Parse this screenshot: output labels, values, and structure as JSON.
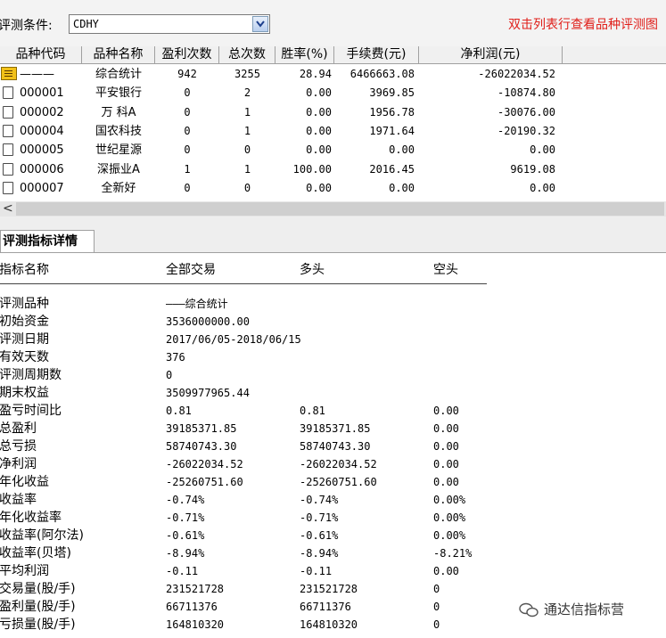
{
  "filter": {
    "label": "评测条件:",
    "value": "CDHY",
    "hint": "双击列表行查看品种评测图"
  },
  "table": {
    "columns": [
      "品种代码",
      "品种名称",
      "盈利次数",
      "总次数",
      "胜率(%)",
      "手续费(元)",
      "净利润(元)"
    ],
    "rows": [
      {
        "code": "———",
        "name": "综合统计",
        "wins": "942",
        "total": "3255",
        "rate": "28.94",
        "fee": "6466663.08",
        "profit": "-26022034.52",
        "icon": "summary-icon"
      },
      {
        "code": "000001",
        "name": "平安银行",
        "wins": "0",
        "total": "2",
        "rate": "0.00",
        "fee": "3969.85",
        "profit": "-10874.80",
        "icon": "document-icon"
      },
      {
        "code": "000002",
        "name": "万 科A",
        "wins": "0",
        "total": "1",
        "rate": "0.00",
        "fee": "1956.78",
        "profit": "-30076.00",
        "icon": "document-icon"
      },
      {
        "code": "000004",
        "name": "国农科技",
        "wins": "0",
        "total": "1",
        "rate": "0.00",
        "fee": "1971.64",
        "profit": "-20190.32",
        "icon": "document-icon"
      },
      {
        "code": "000005",
        "name": "世纪星源",
        "wins": "0",
        "total": "0",
        "rate": "0.00",
        "fee": "0.00",
        "profit": "0.00",
        "icon": "document-icon"
      },
      {
        "code": "000006",
        "name": "深振业A",
        "wins": "1",
        "total": "1",
        "rate": "100.00",
        "fee": "2016.45",
        "profit": "9619.08",
        "icon": "document-icon"
      },
      {
        "code": "000007",
        "name": "全新好",
        "wins": "0",
        "total": "0",
        "rate": "0.00",
        "fee": "0.00",
        "profit": "0.00",
        "icon": "document-icon"
      }
    ]
  },
  "scroll": {
    "left_arrow": "<"
  },
  "tab": {
    "label": "评测指标详情"
  },
  "details": {
    "headers": [
      "指标名称",
      "全部交易",
      "多头",
      "空头"
    ],
    "rows": [
      {
        "name": "评测品种",
        "all": "———综合统计",
        "long": "",
        "short": ""
      },
      {
        "name": "初始资金",
        "all": "3536000000.00",
        "long": "",
        "short": ""
      },
      {
        "name": "评测日期",
        "all": "2017/06/05-2018/06/15",
        "long": "",
        "short": ""
      },
      {
        "name": "有效天数",
        "all": "376",
        "long": "",
        "short": ""
      },
      {
        "name": "评测周期数",
        "all": "0",
        "long": "",
        "short": ""
      },
      {
        "name": "期末权益",
        "all": "3509977965.44",
        "long": "",
        "short": ""
      },
      {
        "name": "盈亏时间比",
        "all": "0.81",
        "long": "0.81",
        "short": "0.00"
      },
      {
        "name": "总盈利",
        "all": "39185371.85",
        "long": "39185371.85",
        "short": "0.00"
      },
      {
        "name": "总亏损",
        "all": "58740743.30",
        "long": "58740743.30",
        "short": "0.00"
      },
      {
        "name": "净利润",
        "all": "-26022034.52",
        "long": "-26022034.52",
        "short": "0.00"
      },
      {
        "name": "年化收益",
        "all": "-25260751.60",
        "long": "-25260751.60",
        "short": "0.00"
      },
      {
        "name": "收益率",
        "all": "-0.74%",
        "long": "-0.74%",
        "short": "0.00%"
      },
      {
        "name": "年化收益率",
        "all": "-0.71%",
        "long": "-0.71%",
        "short": "0.00%"
      },
      {
        "name": "收益率(阿尔法)",
        "all": "-0.61%",
        "long": "-0.61%",
        "short": "0.00%"
      },
      {
        "name": "收益率(贝塔)",
        "all": "-8.94%",
        "long": "-8.94%",
        "short": "-8.21%"
      },
      {
        "name": "平均利润",
        "all": "-0.11",
        "long": "-0.11",
        "short": "0.00"
      },
      {
        "name": "交易量(股/手)",
        "all": "231521728",
        "long": "231521728",
        "short": "0"
      },
      {
        "name": "盈利量(股/手)",
        "all": "66711376",
        "long": "66711376",
        "short": "0"
      },
      {
        "name": "亏损量(股/手)",
        "all": "164810320",
        "long": "164810320",
        "short": "0"
      }
    ]
  },
  "watermark": {
    "text": "通达信指标营"
  }
}
